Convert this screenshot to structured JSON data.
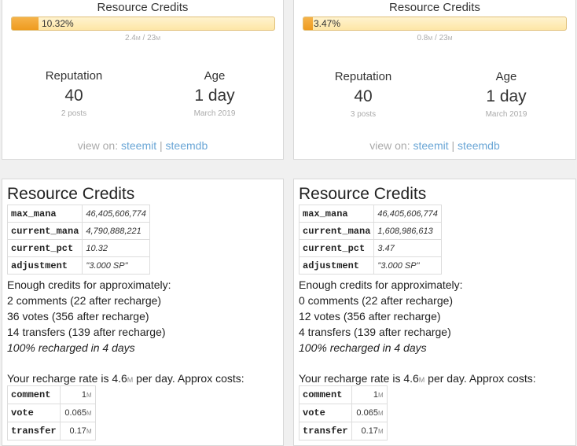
{
  "accounts": [
    {
      "rc_title": "Resource Credits",
      "rc_percent_label": "10.32%",
      "rc_fill_pct": 10.32,
      "rc_current": "2.4",
      "rc_max": "23",
      "rc_unit": "M",
      "reputation_label": "Reputation",
      "reputation_value": "40",
      "posts": "2 posts",
      "age_label": "Age",
      "age_value": "1 day",
      "age_date": "March 2019",
      "view_on_label": "view on:",
      "view_link_1": "steemit",
      "view_sep": "|",
      "view_link_2": "steemdb",
      "resource_heading": "Resource Credits",
      "rows": [
        {
          "key": "max_mana",
          "val": "46,405,606,774"
        },
        {
          "key": "current_mana",
          "val": "4,790,888,221"
        },
        {
          "key": "current_pct",
          "val": "10.32"
        },
        {
          "key": "adjustment",
          "val": "\"3.000 SP\""
        }
      ],
      "enough_label": "Enough credits for approximately:",
      "comments_line": "2 comments (22 after recharge)",
      "votes_line": "36 votes (356 after recharge)",
      "transfers_line": "14 transfers (139 after recharge)",
      "recharge_line": "100% recharged in 4 days",
      "rate_prefix": "Your recharge rate is 4.6",
      "rate_unit": "M",
      "rate_suffix": " per day. Approx costs:",
      "costs": [
        {
          "key": "comment",
          "val": "1",
          "unit": "M"
        },
        {
          "key": "vote",
          "val": "0.065",
          "unit": "M"
        },
        {
          "key": "transfer",
          "val": "0.17",
          "unit": "M"
        }
      ]
    },
    {
      "rc_title": "Resource Credits",
      "rc_percent_label": "3.47%",
      "rc_fill_pct": 3.47,
      "rc_current": "0.8",
      "rc_max": "23",
      "rc_unit": "M",
      "reputation_label": "Reputation",
      "reputation_value": "40",
      "posts": "3 posts",
      "age_label": "Age",
      "age_value": "1 day",
      "age_date": "March 2019",
      "view_on_label": "view on:",
      "view_link_1": "steemit",
      "view_sep": "|",
      "view_link_2": "steemdb",
      "resource_heading": "Resource Credits",
      "rows": [
        {
          "key": "max_mana",
          "val": "46,405,606,774"
        },
        {
          "key": "current_mana",
          "val": "1,608,986,613"
        },
        {
          "key": "current_pct",
          "val": "3.47"
        },
        {
          "key": "adjustment",
          "val": "\"3.000 SP\""
        }
      ],
      "enough_label": "Enough credits for approximately:",
      "comments_line": "0 comments (22 after recharge)",
      "votes_line": "12 votes (356 after recharge)",
      "transfers_line": "4 transfers (139 after recharge)",
      "recharge_line": "100% recharged in 4 days",
      "rate_prefix": "Your recharge rate is 4.6",
      "rate_unit": "M",
      "rate_suffix": " per day. Approx costs:",
      "costs": [
        {
          "key": "comment",
          "val": "1",
          "unit": "M"
        },
        {
          "key": "vote",
          "val": "0.065",
          "unit": "M"
        },
        {
          "key": "transfer",
          "val": "0.17",
          "unit": "M"
        }
      ]
    }
  ]
}
